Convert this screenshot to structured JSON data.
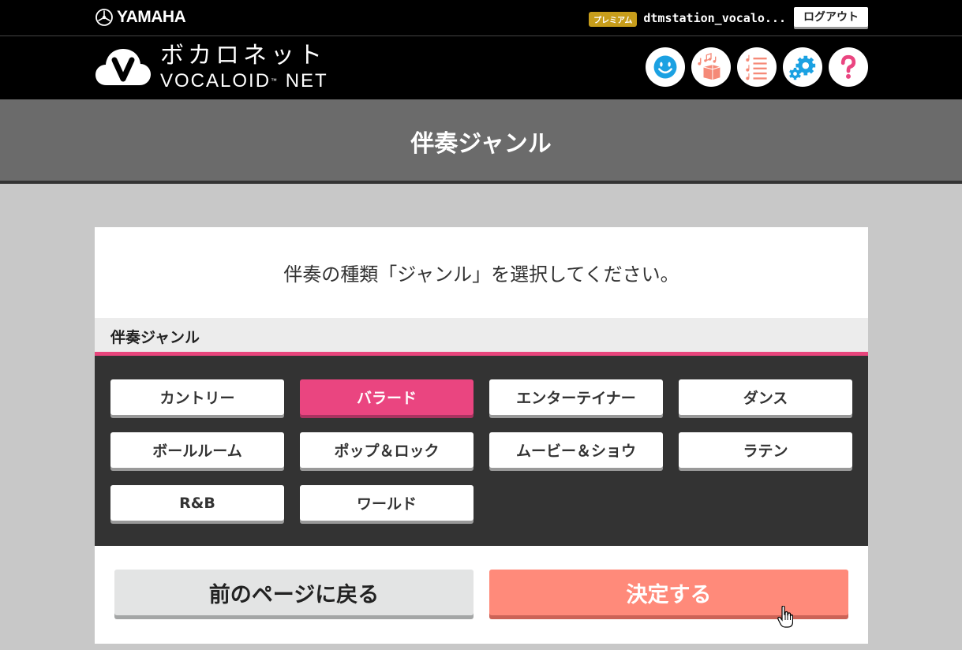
{
  "header": {
    "brand": "YAMAHA",
    "premium_badge": "プレミアム",
    "username": "dtmstation_vocalo...",
    "logout_label": "ログアウト"
  },
  "logo": {
    "jp": "ボカロネット",
    "en": "VOCALOID",
    "en_tm": "™",
    "en_suffix": " NET"
  },
  "nav_icons": [
    "smiley-icon",
    "music-box-icon",
    "music-list-icon",
    "settings-icon",
    "help-icon"
  ],
  "banner": {
    "title": "伴奏ジャンル"
  },
  "instruction": "伴奏の種類「ジャンル」を選択してください。",
  "section": {
    "title": "伴奏ジャンル"
  },
  "genres": [
    {
      "label": "カントリー",
      "selected": false
    },
    {
      "label": "バラード",
      "selected": true
    },
    {
      "label": "エンターテイナー",
      "selected": false
    },
    {
      "label": "ダンス",
      "selected": false
    },
    {
      "label": "ボールルーム",
      "selected": false
    },
    {
      "label": "ポップ＆ロック",
      "selected": false
    },
    {
      "label": "ムービー＆ショウ",
      "selected": false
    },
    {
      "label": "ラテン",
      "selected": false
    },
    {
      "label": "R&B",
      "selected": false
    },
    {
      "label": "ワールド",
      "selected": false
    }
  ],
  "actions": {
    "back_label": "前のページに戻る",
    "confirm_label": "決定する"
  },
  "colors": {
    "accent_pink": "#ea4580",
    "confirm_salmon": "#ff8a7a",
    "premium_gold": "#c79d1b",
    "icon_blue": "#1ba1e2"
  }
}
